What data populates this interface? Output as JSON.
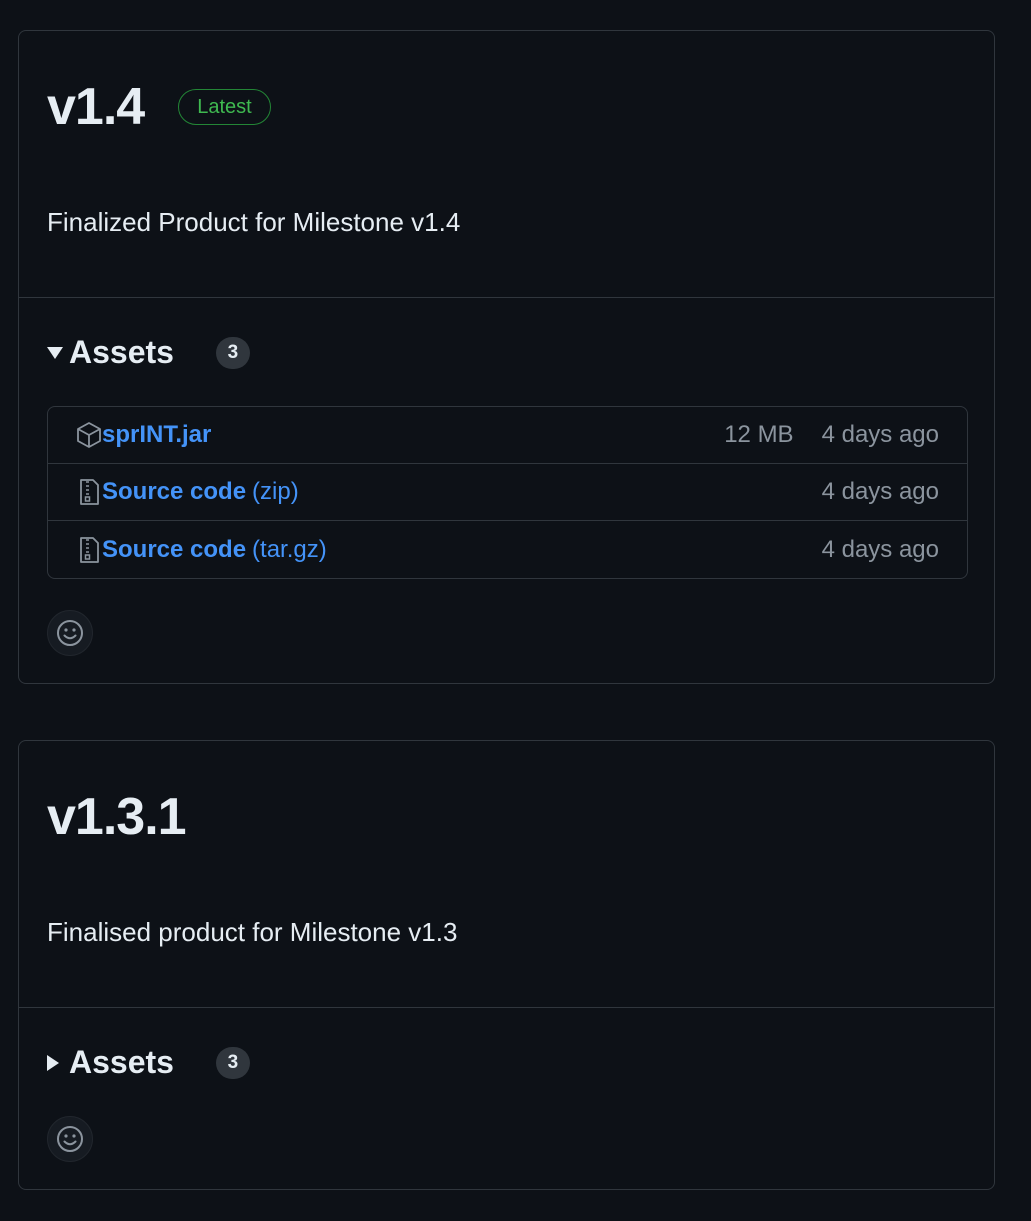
{
  "releases": [
    {
      "version": "v1.4",
      "badge": "Latest",
      "description": "Finalized Product for Milestone v1.4",
      "assets_label": "Assets",
      "assets_count": "3",
      "assets_expanded": true,
      "assets": [
        {
          "icon": "package-icon",
          "name": "sprINT.jar",
          "ext": "",
          "size": "12 MB",
          "date": "4 days ago"
        },
        {
          "icon": "file-zip-icon",
          "name": "Source code",
          "ext": "(zip)",
          "size": "",
          "date": "4 days ago"
        },
        {
          "icon": "file-zip-icon",
          "name": "Source code",
          "ext": "(tar.gz)",
          "size": "",
          "date": "4 days ago"
        }
      ],
      "reaction_icon": "smiley-icon"
    },
    {
      "version": "v1.3.1",
      "description": "Finalised product for Milestone v1.3",
      "assets_label": "Assets",
      "assets_count": "3",
      "assets_expanded": false,
      "reaction_icon": "smiley-icon"
    }
  ],
  "colors": {
    "background": "#0d1117",
    "border": "#30363d",
    "link": "#4493f8",
    "latest_green": "#3fb950",
    "muted": "#8b949e"
  }
}
